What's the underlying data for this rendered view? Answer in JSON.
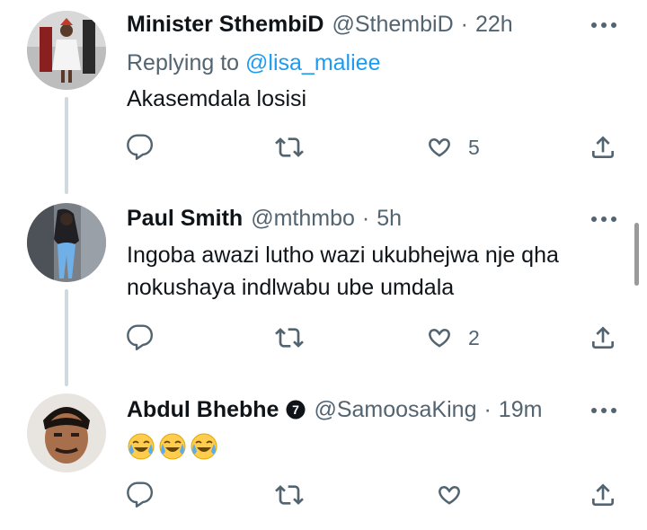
{
  "tweets": [
    {
      "author": "Minister SthembiD",
      "handle": "@SthembiD",
      "time": "22h",
      "replying_label": "Replying to",
      "replying_to": "@lisa_maliee",
      "text": "Akasemdala losisi",
      "likes": "5"
    },
    {
      "author": "Paul Smith",
      "handle": "@mthmbo",
      "time": "5h",
      "text_line1": "Ingoba awazi lutho wazi ukubhejwa nje qha",
      "text_line2": "nokushaya indlwabu ube umdala",
      "likes": "2"
    },
    {
      "author": "Abdul Bhebhe",
      "handle": "@SamoosaKing",
      "time": "19m",
      "verified_badge": "7",
      "emojis": [
        "😂",
        "😂",
        "😂"
      ]
    }
  ],
  "separator": "·",
  "colors": {
    "text": "#0f1419",
    "secondary": "#536471",
    "link": "#1d9bf0",
    "thread_line": "#cfd9de"
  },
  "icons": [
    "reply-icon",
    "retweet-icon",
    "like-icon",
    "share-icon",
    "more-icon",
    "verified-badge-icon"
  ]
}
